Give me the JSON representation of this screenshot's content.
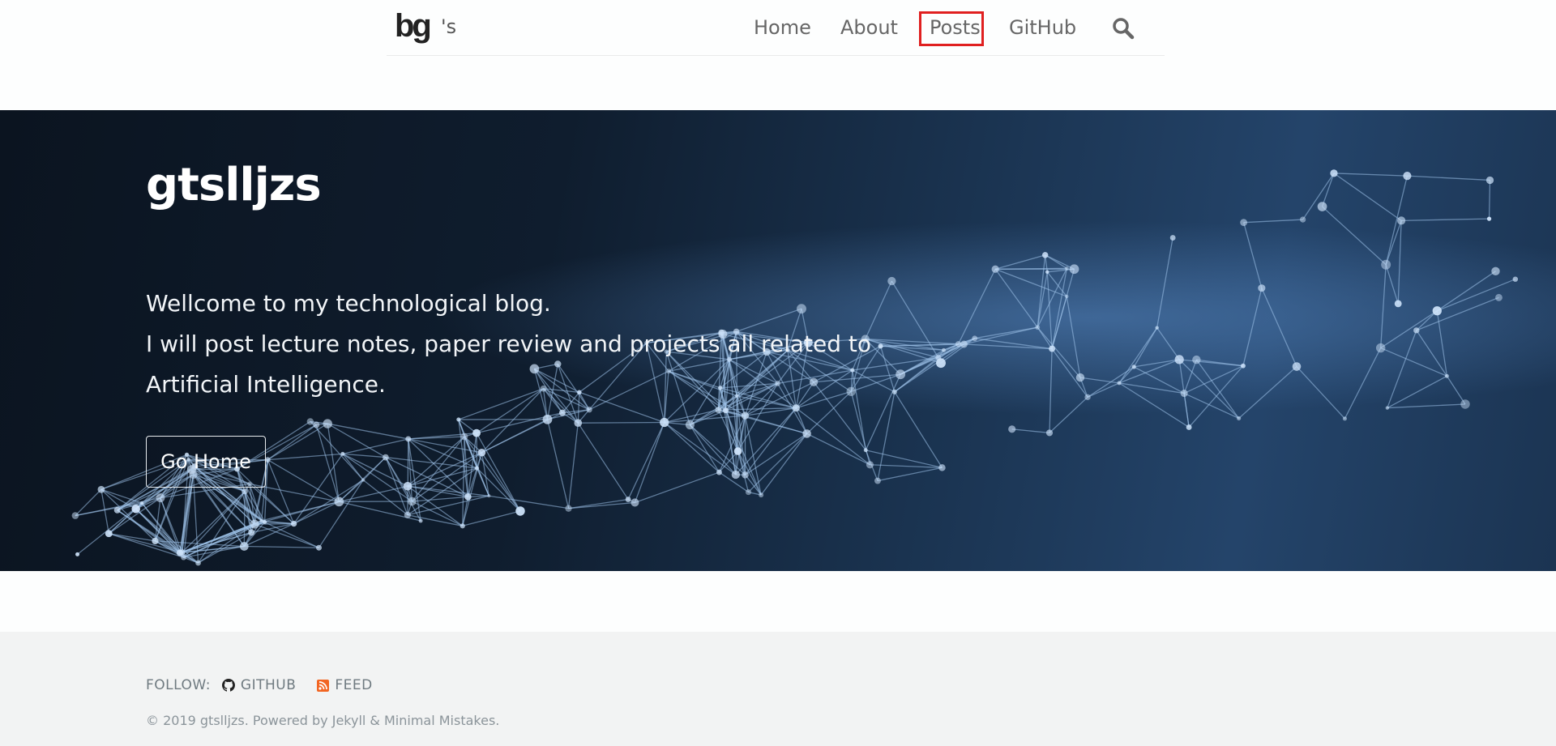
{
  "header": {
    "logo_text": "bg",
    "site_suffix": "'s",
    "nav": [
      {
        "label": "Home"
      },
      {
        "label": "About"
      },
      {
        "label": "Posts"
      },
      {
        "label": "GitHub"
      }
    ],
    "search_icon": "search-icon"
  },
  "hero": {
    "title": "gtslljzs",
    "description_lines": [
      "Wellcome to my technological blog.",
      "I will post lecture notes, paper review and projects all related to",
      "Artificial Intelligence."
    ],
    "button_label": "Go Home"
  },
  "footer": {
    "follow_label": "FOLLOW:",
    "links": [
      {
        "label": "GITHUB",
        "icon": "github-icon"
      },
      {
        "label": "FEED",
        "icon": "rss-icon",
        "color": "#f26522"
      }
    ],
    "copyright": "© 2019 gtslljzs. Powered by Jekyll & Minimal Mistakes."
  },
  "colors": {
    "highlight_border": "#e02020",
    "footer_bg": "#f2f3f3",
    "hero_dark": "#0b1420",
    "hero_light": "#24446a"
  }
}
